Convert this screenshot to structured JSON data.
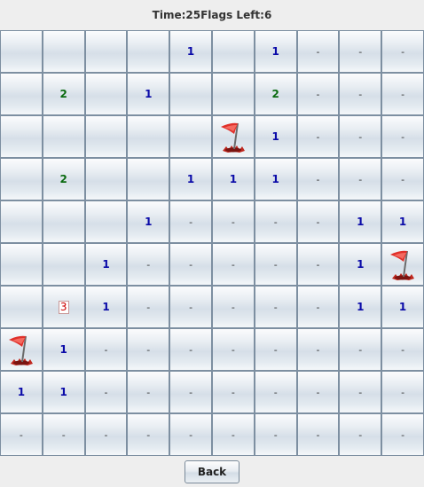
{
  "status": {
    "time_label": "Time:",
    "time_value": "25",
    "flags_label": "Flags Left:",
    "flags_value": "6"
  },
  "board": {
    "rows": [
      [
        "",
        "",
        "",
        "",
        "1",
        "",
        "1",
        "-",
        "-",
        "-"
      ],
      [
        "",
        "2",
        "",
        "1",
        "",
        "",
        "2",
        "-",
        "-",
        "-"
      ],
      [
        "",
        "",
        "",
        "",
        "",
        "flag",
        "1",
        "-",
        "-",
        "-"
      ],
      [
        "",
        "2",
        "",
        "",
        "1",
        "1",
        "1",
        "-",
        "-",
        "-"
      ],
      [
        "",
        "",
        "",
        "1",
        "-",
        "-",
        "-",
        "-",
        "1",
        "1"
      ],
      [
        "",
        "",
        "1",
        "-",
        "-",
        "-",
        "-",
        "-",
        "1",
        "flag"
      ],
      [
        "",
        "3",
        "1",
        "-",
        "-",
        "-",
        "-",
        "-",
        "1",
        "1"
      ],
      [
        "flag",
        "1",
        "-",
        "-",
        "-",
        "-",
        "-",
        "-",
        "-",
        "-"
      ],
      [
        "1",
        "1",
        "-",
        "-",
        "-",
        "-",
        "-",
        "-",
        "-",
        "-"
      ],
      [
        "-",
        "-",
        "-",
        "-",
        "-",
        "-",
        "-",
        "-",
        "-",
        "-"
      ]
    ],
    "flag_icon": "flag-icon",
    "colors": {
      "number_1": "#0a0aa8",
      "number_2": "#0a6a10",
      "number_3": "#cc0000",
      "flag_red": "#e0302a"
    }
  },
  "footer": {
    "back_label": "Back"
  }
}
